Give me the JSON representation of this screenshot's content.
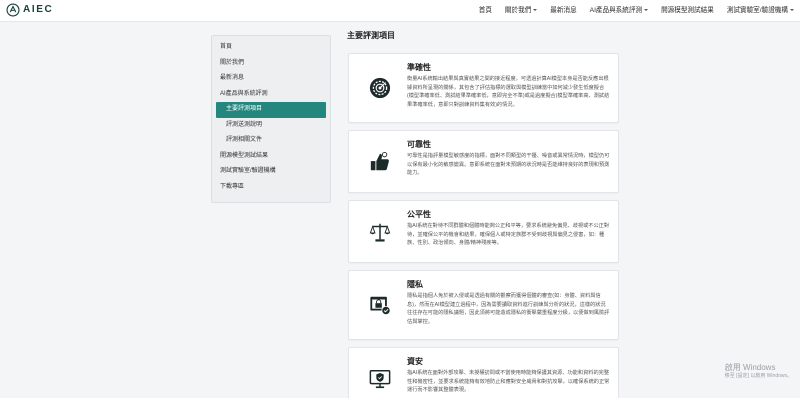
{
  "brand": {
    "name": "AIEC"
  },
  "nav": {
    "items": [
      {
        "label": "首頁",
        "dropdown": false
      },
      {
        "label": "關於我們",
        "dropdown": true
      },
      {
        "label": "最新消息",
        "dropdown": false
      },
      {
        "label": "AI產品與系統評測",
        "dropdown": true
      },
      {
        "label": "開源模型測試結果",
        "dropdown": false
      },
      {
        "label": "測試實驗室/驗證機構",
        "dropdown": true
      }
    ]
  },
  "sidebar": {
    "items": [
      {
        "label": "首頁"
      },
      {
        "label": "關於我們"
      },
      {
        "label": "最新消息"
      },
      {
        "label": "AI產品與系統評測"
      },
      {
        "label": "主要評測項目",
        "active": true
      },
      {
        "label": "評測送測說明"
      },
      {
        "label": "評測相關文件"
      },
      {
        "label": "開源模型測試結果"
      },
      {
        "label": "測試實驗室/驗證機構"
      },
      {
        "label": "下載專區"
      }
    ]
  },
  "main": {
    "title": "主要評測項目",
    "cards": [
      {
        "icon": "target-gear-icon",
        "title": "準確性",
        "desc": "衡量AI系統輸出結果與真實結果之間的接近程度，可透過計算AI模型本身是否能反應出根據資料所呈現的關係，其包含了評估指標的選取與模型訓練當中如何減少發生低度擬合(模型準確率低、測試結果準確率低，意即完全不準)或是過度擬合(模型準確率高、測試結果準確率低，意即只對訓練資料集有效)的情況。"
      },
      {
        "icon": "thumbs-up-icon",
        "title": "可靠性",
        "desc": "可靠性是指評量模型敏感度的指標，面對不同類型的干擾、噪音或異常情況時，模型仍可以保有最小化的敏感變異。意即系統在面對未預期的狀況時是否能維持良好的表現和預測能力。"
      },
      {
        "icon": "balance-scale-icon",
        "title": "公平性",
        "desc": "指AI系統在對待不同群體和個體時能夠公正和平等，要求系統避免偏見、歧視或不公正對待，並確保公平的機會和結果，確保個人或特定族群不受到歧視與偏見之侵害，如：種族、性別、政治傾向、身體/精神殘疾等。"
      },
      {
        "icon": "privacy-lock-icon",
        "title": "隱私",
        "desc": "隱私是指個人免於被入侵或是透過有關的觀察而獲得個體的審查(如：身體、資料與信息)，然而在AI模型建立過程中，因為需要讀取資料進行訓練與分析的狀況，這樣的狀況往往存在可能的隱私議題，因此須將可能造成隱私的衝擊嚴重程度分級，以便做到風險評估與掌控。"
      },
      {
        "icon": "security-monitor-icon",
        "title": "資安",
        "desc": "指AI系統在面對外部攻擊、未授權訪問或不當使用時能夠保護其資源、功能和資料的完整性和機密性，並要求系統能夠有效地防止和應對安全威脅和對抗攻擊，以確保系統的正常運行而不影響其整體表現。"
      }
    ]
  },
  "watermark": {
    "title": "啟用 Windows",
    "subtitle": "移至 [設定] 以啟用 Windows。"
  },
  "colors": {
    "accent": "#24877e",
    "logo": "#17423c",
    "background": "#f4f5f6"
  }
}
